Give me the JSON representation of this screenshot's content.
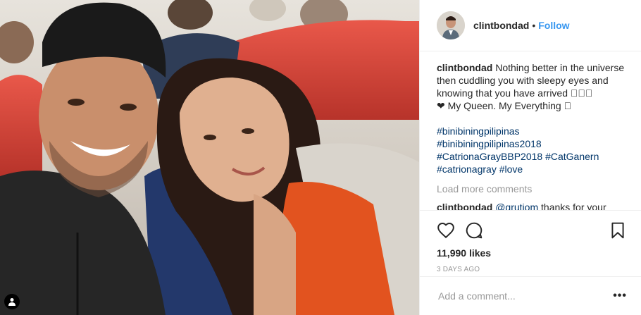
{
  "header": {
    "username": "clintbondad",
    "separator": "•",
    "follow_label": "Follow"
  },
  "caption": {
    "username": "clintbondad",
    "text": "Nothing better in the universe then cuddling you with sleepy eyes and knowing that you have arrived 🏼🏼🏼",
    "line2": "❤ My Queen. My Everything 🏼",
    "hashtags": [
      "#binibiningpilipinas",
      "#binibiningpilipinas2018",
      "#CatrionaGrayBBP2018",
      "#CatGanern",
      "#catrionagray",
      "#love"
    ]
  },
  "load_more": "Load more comments",
  "comment": {
    "username": "clintbondad",
    "mention": "@grutjom",
    "text": "thanks for your"
  },
  "likes": "11,990 likes",
  "timestamp": "3 DAYS AGO",
  "add_comment_placeholder": "Add a comment...",
  "more_options": "•••",
  "icons": {
    "like": "heart-icon",
    "comment": "comment-icon",
    "save": "bookmark-icon",
    "more": "more-options-icon",
    "tag": "user-tag-icon"
  },
  "colors": {
    "link": "#3897f0",
    "hashtag": "#003569",
    "muted": "#999999",
    "text": "#262626"
  }
}
